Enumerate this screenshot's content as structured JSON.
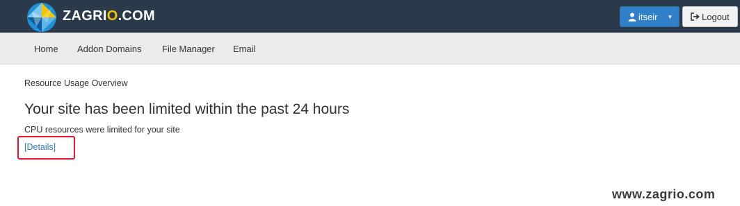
{
  "header": {
    "brand_prefix": "ZAGRI",
    "brand_accent": "O",
    "brand_suffix": ".COM",
    "user_label": "itseir",
    "logout_label": "Logout"
  },
  "nav": {
    "items": [
      {
        "label": "Home"
      },
      {
        "label": "Addon Domains"
      },
      {
        "label": "File Manager"
      },
      {
        "label": "Email"
      }
    ]
  },
  "main": {
    "breadcrumb": "Resource Usage Overview",
    "title": "Your site has been limited within the past 24 hours",
    "description": "CPU resources were limited for your site",
    "details_link": "[Details]"
  },
  "watermark": "www.zagrio.com",
  "colors": {
    "header_bg": "#2b3a4a",
    "nav_bg": "#ebebeb",
    "primary_button": "#2f80c9",
    "link": "#2a7bc4",
    "highlight": "#e0182d",
    "brand_accent": "#f5c400"
  }
}
